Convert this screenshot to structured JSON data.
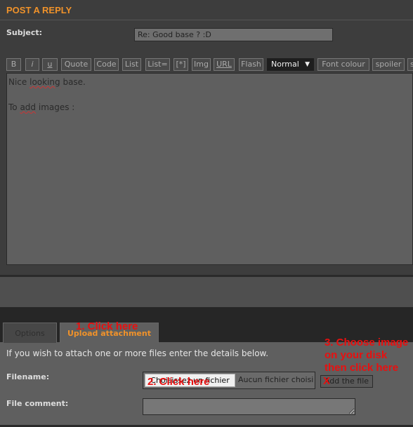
{
  "header": {
    "title": "POST A REPLY"
  },
  "subject": {
    "label": "Subject:",
    "value": "Re: Good base ? :D"
  },
  "toolbar": {
    "buttons": [
      "B",
      "i",
      "u",
      "Quote",
      "Code",
      "List",
      "List=",
      "[*]",
      "Img",
      "URL",
      "Flash"
    ],
    "font_size": "Normal",
    "font_colour": "Font colour",
    "spoiler": "spoiler",
    "more": "s"
  },
  "editor": {
    "line1_a": "Nice ",
    "line1_b": "looking",
    "line1_c": " base.",
    "line2_a": "To ",
    "line2_b": "add",
    "line2_c": " images :"
  },
  "tabs": {
    "options": "Options",
    "upload": "Upload attachment"
  },
  "attach": {
    "intro": "If you wish to attach one or more files enter the details below.",
    "filename_label": "Filename:",
    "choose_button": "Choisissez un fichier",
    "no_file": "Aucun fichier choisi",
    "add_button": "Add the file",
    "comment_label": "File comment:"
  },
  "annotations": {
    "step1": "1. Click here",
    "step2": "2. Click here",
    "step3_l1": "3. Choose image",
    "step3_l2": "on your disk",
    "step3_l3": "then click here",
    "mark": "X"
  },
  "colors": {
    "accent": "#f0922a",
    "annotation": "#e81010"
  }
}
